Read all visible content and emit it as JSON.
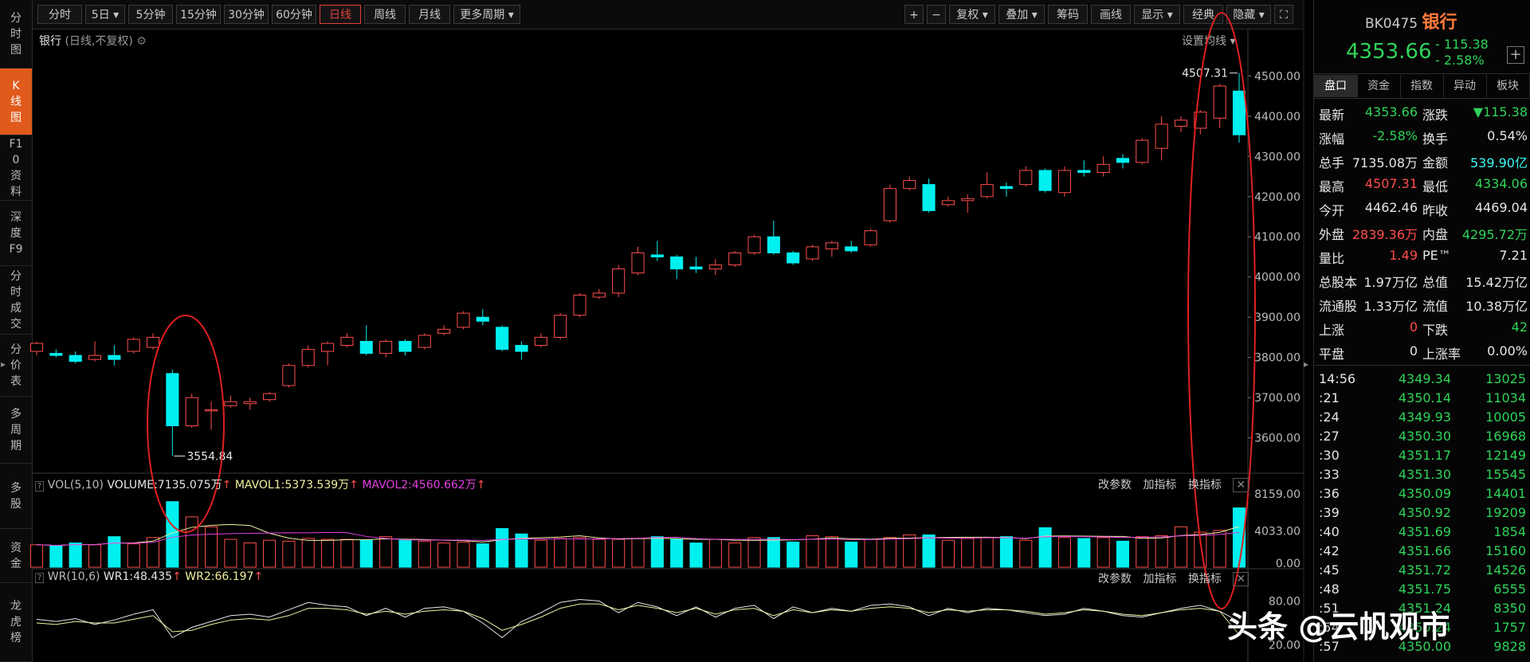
{
  "left_nav": [
    {
      "label": "分时图",
      "active": false
    },
    {
      "label": "K线图",
      "active": true
    },
    {
      "label": "F10资料",
      "active": false
    },
    {
      "label": "深度F9",
      "active": false
    },
    {
      "label": "分时成交",
      "active": false
    },
    {
      "label": "分价表",
      "active": false
    },
    {
      "label": "多周期",
      "active": false
    },
    {
      "label": "多股",
      "active": false
    },
    {
      "label": "资金",
      "active": false
    },
    {
      "label": "龙虎榜",
      "active": false
    }
  ],
  "toolbar": {
    "periods": [
      "分时",
      "5日 ▾",
      "5分钟",
      "15分钟",
      "30分钟",
      "60分钟",
      "日线",
      "周线",
      "月线",
      "更多周期 ▾"
    ],
    "active_period": "日线",
    "right_buttons": [
      "+",
      "−",
      "复权 ▾",
      "叠加 ▾",
      "筹码",
      "画线",
      "显示 ▾",
      "经典",
      "隐藏 ▾",
      "⛶"
    ]
  },
  "chart_header": {
    "name": "银行",
    "subtitle": "(日线,不复权)",
    "ma_settings": "设置均线 ▾",
    "high_label": "4507.31",
    "low_label": "3554.84",
    "y_ticks": [
      "4500.00",
      "4400.00",
      "4300.00",
      "4200.00",
      "4100.00",
      "4000.00",
      "3900.00",
      "3800.00",
      "3700.00",
      "3600.00"
    ]
  },
  "volume_panel": {
    "indicator": "VOL(5,10)",
    "volume": "VOLUME:7135.075万",
    "mavol1": "MAVOL1:5373.539万",
    "mavol2": "MAVOL2:4560.662万",
    "buttons": [
      "改参数",
      "加指标",
      "换指标"
    ],
    "y_ticks": [
      "8159.00",
      "4033.00",
      "0.00"
    ]
  },
  "wr_panel": {
    "indicator": "WR(10,6)",
    "wr1": "WR1:48.435",
    "wr2": "WR2:66.197",
    "buttons": [
      "改参数",
      "加指标",
      "换指标"
    ],
    "y_ticks": [
      "80.00",
      "20.00"
    ]
  },
  "quote": {
    "code": "BK0475",
    "name": "银行",
    "price": "4353.66",
    "change": "- 115.38",
    "change_pct": "- 2.58%",
    "tabs": [
      "盘口",
      "资金",
      "指数",
      "异动",
      "板块"
    ],
    "rows": [
      {
        "l1": "最新",
        "v1": "4353.66",
        "c1": "green",
        "l2": "涨跌",
        "v2": "▼115.38",
        "c2": "green"
      },
      {
        "l1": "涨幅",
        "v1": "-2.58%",
        "c1": "green",
        "l2": "换手",
        "v2": "0.54%",
        "c2": "white"
      },
      {
        "l1": "总手",
        "v1": "7135.08万",
        "c1": "white",
        "l2": "金额",
        "v2": "539.90亿",
        "c2": "cyan"
      },
      {
        "l1": "最高",
        "v1": "4507.31",
        "c1": "red",
        "l2": "最低",
        "v2": "4334.06",
        "c2": "green"
      },
      {
        "l1": "今开",
        "v1": "4462.46",
        "c1": "white",
        "l2": "昨收",
        "v2": "4469.04",
        "c2": "white"
      },
      {
        "l1": "外盘",
        "v1": "2839.36万",
        "c1": "red",
        "l2": "内盘",
        "v2": "4295.72万",
        "c2": "green"
      },
      {
        "l1": "量比",
        "v1": "1.49",
        "c1": "red",
        "l2": "PE™",
        "v2": "7.21",
        "c2": "white"
      },
      {
        "l1": "总股本",
        "v1": "1.97万亿",
        "c1": "white",
        "l2": "总值",
        "v2": "15.42万亿",
        "c2": "white"
      },
      {
        "l1": "流通股",
        "v1": "1.33万亿",
        "c1": "white",
        "l2": "流值",
        "v2": "10.38万亿",
        "c2": "white"
      },
      {
        "l1": "上涨",
        "v1": "0",
        "c1": "red",
        "l2": "下跌",
        "v2": "42",
        "c2": "green"
      },
      {
        "l1": "平盘",
        "v1": "0",
        "c1": "white",
        "l2": "上涨率",
        "v2": "0.00%",
        "c2": "white"
      }
    ],
    "ticks": [
      {
        "t": "14:56",
        "p": "4349.34",
        "v": "13025"
      },
      {
        "t": ":21",
        "p": "4350.14",
        "v": "11034"
      },
      {
        "t": ":24",
        "p": "4349.93",
        "v": "10005"
      },
      {
        "t": ":27",
        "p": "4350.30",
        "v": "16968"
      },
      {
        "t": ":30",
        "p": "4351.17",
        "v": "12149"
      },
      {
        "t": ":33",
        "p": "4351.30",
        "v": "15545"
      },
      {
        "t": ":36",
        "p": "4350.09",
        "v": "14401"
      },
      {
        "t": ":39",
        "p": "4350.92",
        "v": "19209"
      },
      {
        "t": ":40",
        "p": "4351.69",
        "v": "1854"
      },
      {
        "t": ":42",
        "p": "4351.66",
        "v": "15160"
      },
      {
        "t": ":45",
        "p": "4351.72",
        "v": "14526"
      },
      {
        "t": ":48",
        "p": "4351.75",
        "v": "6555"
      },
      {
        "t": ":51",
        "p": "4351.24",
        "v": "8350"
      },
      {
        "t": ":54",
        "p": "4350.24",
        "v": "1757"
      },
      {
        "t": ":57",
        "p": "4350.00",
        "v": "9828"
      }
    ]
  },
  "watermark": "头条 @云帆观市",
  "colors": {
    "up": "#ff4d4d",
    "down": "#00f0f0",
    "accent": "#e05a1b",
    "ma1": "#f0f0a0",
    "ma2": "#e040e0",
    "circle": "#e02020"
  },
  "chart_data": {
    "type": "candlestick",
    "series": [
      {
        "o": 3815,
        "c": 3835,
        "h": 3840,
        "l": 3805
      },
      {
        "o": 3810,
        "c": 3805,
        "h": 3820,
        "l": 3800
      },
      {
        "o": 3805,
        "c": 3790,
        "h": 3815,
        "l": 3785
      },
      {
        "o": 3795,
        "c": 3805,
        "h": 3840,
        "l": 3790
      },
      {
        "o": 3805,
        "c": 3795,
        "h": 3830,
        "l": 3780
      },
      {
        "o": 3815,
        "c": 3845,
        "h": 3850,
        "l": 3810
      },
      {
        "o": 3825,
        "c": 3850,
        "h": 3860,
        "l": 3820
      },
      {
        "o": 3760,
        "c": 3630,
        "h": 3770,
        "l": 3554.84
      },
      {
        "o": 3630,
        "c": 3700,
        "h": 3710,
        "l": 3625
      },
      {
        "o": 3670,
        "c": 3670,
        "h": 3690,
        "l": 3620
      },
      {
        "o": 3680,
        "c": 3690,
        "h": 3705,
        "l": 3675
      },
      {
        "o": 3685,
        "c": 3690,
        "h": 3700,
        "l": 3670
      },
      {
        "o": 3695,
        "c": 3710,
        "h": 3715,
        "l": 3690
      },
      {
        "o": 3730,
        "c": 3780,
        "h": 3785,
        "l": 3725
      },
      {
        "o": 3780,
        "c": 3820,
        "h": 3830,
        "l": 3775
      },
      {
        "o": 3815,
        "c": 3835,
        "h": 3840,
        "l": 3780
      },
      {
        "o": 3830,
        "c": 3850,
        "h": 3860,
        "l": 3825
      },
      {
        "o": 3840,
        "c": 3810,
        "h": 3880,
        "l": 3805
      },
      {
        "o": 3810,
        "c": 3840,
        "h": 3845,
        "l": 3800
      },
      {
        "o": 3840,
        "c": 3815,
        "h": 3845,
        "l": 3805
      },
      {
        "o": 3825,
        "c": 3855,
        "h": 3860,
        "l": 3820
      },
      {
        "o": 3860,
        "c": 3870,
        "h": 3880,
        "l": 3855
      },
      {
        "o": 3875,
        "c": 3910,
        "h": 3915,
        "l": 3870
      },
      {
        "o": 3900,
        "c": 3890,
        "h": 3920,
        "l": 3880
      },
      {
        "o": 3875,
        "c": 3820,
        "h": 3880,
        "l": 3815
      },
      {
        "o": 3830,
        "c": 3815,
        "h": 3840,
        "l": 3795
      },
      {
        "o": 3830,
        "c": 3850,
        "h": 3860,
        "l": 3825
      },
      {
        "o": 3850,
        "c": 3905,
        "h": 3910,
        "l": 3845
      },
      {
        "o": 3905,
        "c": 3955,
        "h": 3960,
        "l": 3900
      },
      {
        "o": 3950,
        "c": 3960,
        "h": 3970,
        "l": 3945
      },
      {
        "o": 3960,
        "c": 4020,
        "h": 4030,
        "l": 3950
      },
      {
        "o": 4010,
        "c": 4060,
        "h": 4075,
        "l": 4005
      },
      {
        "o": 4055,
        "c": 4050,
        "h": 4090,
        "l": 4040
      },
      {
        "o": 4050,
        "c": 4020,
        "h": 4055,
        "l": 3995
      },
      {
        "o": 4025,
        "c": 4020,
        "h": 4050,
        "l": 4010
      },
      {
        "o": 4020,
        "c": 4030,
        "h": 4045,
        "l": 4005
      },
      {
        "o": 4030,
        "c": 4060,
        "h": 4065,
        "l": 4025
      },
      {
        "o": 4060,
        "c": 4100,
        "h": 4105,
        "l": 4055
      },
      {
        "o": 4100,
        "c": 4060,
        "h": 4140,
        "l": 4055
      },
      {
        "o": 4060,
        "c": 4035,
        "h": 4065,
        "l": 4030
      },
      {
        "o": 4045,
        "c": 4075,
        "h": 4080,
        "l": 4040
      },
      {
        "o": 4070,
        "c": 4085,
        "h": 4090,
        "l": 4050
      },
      {
        "o": 4075,
        "c": 4065,
        "h": 4090,
        "l": 4060
      },
      {
        "o": 4080,
        "c": 4115,
        "h": 4120,
        "l": 4075
      },
      {
        "o": 4140,
        "c": 4220,
        "h": 4230,
        "l": 4135
      },
      {
        "o": 4220,
        "c": 4240,
        "h": 4250,
        "l": 4215
      },
      {
        "o": 4230,
        "c": 4165,
        "h": 4245,
        "l": 4160
      },
      {
        "o": 4180,
        "c": 4190,
        "h": 4200,
        "l": 4175
      },
      {
        "o": 4190,
        "c": 4195,
        "h": 4205,
        "l": 4160
      },
      {
        "o": 4200,
        "c": 4230,
        "h": 4260,
        "l": 4195
      },
      {
        "o": 4225,
        "c": 4220,
        "h": 4235,
        "l": 4200
      },
      {
        "o": 4230,
        "c": 4265,
        "h": 4275,
        "l": 4225
      },
      {
        "o": 4265,
        "c": 4215,
        "h": 4270,
        "l": 4210
      },
      {
        "o": 4210,
        "c": 4265,
        "h": 4275,
        "l": 4200
      },
      {
        "o": 4265,
        "c": 4260,
        "h": 4290,
        "l": 4250
      },
      {
        "o": 4260,
        "c": 4280,
        "h": 4300,
        "l": 4250
      },
      {
        "o": 4295,
        "c": 4285,
        "h": 4305,
        "l": 4270
      },
      {
        "o": 4285,
        "c": 4340,
        "h": 4345,
        "l": 4280
      },
      {
        "o": 4320,
        "c": 4380,
        "h": 4400,
        "l": 4290
      },
      {
        "o": 4375,
        "c": 4390,
        "h": 4400,
        "l": 4360
      },
      {
        "o": 4370,
        "c": 4410,
        "h": 4415,
        "l": 4355
      },
      {
        "o": 4395,
        "c": 4475,
        "h": 4480,
        "l": 4370
      },
      {
        "o": 4462.46,
        "c": 4353.66,
        "h": 4507.31,
        "l": 4334.06
      }
    ],
    "volume": [
      2500,
      2350,
      2700,
      2500,
      3400,
      2600,
      3300,
      7300,
      5600,
      4500,
      3100,
      2700,
      3000,
      2900,
      3200,
      3100,
      3100,
      3000,
      3400,
      3000,
      2900,
      2700,
      2800,
      2600,
      4300,
      3700,
      3000,
      3200,
      3300,
      3100,
      3100,
      3200,
      3400,
      3100,
      2700,
      3100,
      2700,
      3300,
      3300,
      2800,
      3500,
      3400,
      2800,
      3100,
      3300,
      3600,
      3600,
      3000,
      3200,
      3300,
      3400,
      3000,
      4400,
      3300,
      3200,
      3300,
      2900,
      3400,
      3500,
      4500,
      3900,
      4100,
      6600
    ],
    "wr1": [
      45,
      48,
      44,
      52,
      46,
      38,
      32,
      70,
      56,
      48,
      40,
      38,
      42,
      32,
      22,
      26,
      28,
      40,
      30,
      42,
      30,
      28,
      34,
      50,
      70,
      48,
      36,
      22,
      18,
      20,
      36,
      22,
      28,
      40,
      28,
      42,
      30,
      26,
      44,
      28,
      36,
      30,
      34,
      26,
      24,
      28,
      40,
      30,
      36,
      30,
      32,
      36,
      40,
      38,
      30,
      34,
      40,
      42,
      36,
      30,
      26,
      34,
      48
    ],
    "wr2": [
      50,
      52,
      48,
      50,
      50,
      45,
      40,
      62,
      60,
      52,
      46,
      44,
      46,
      40,
      30,
      30,
      32,
      38,
      34,
      38,
      34,
      32,
      34,
      44,
      60,
      52,
      42,
      30,
      24,
      24,
      32,
      26,
      30,
      36,
      30,
      38,
      32,
      30,
      40,
      32,
      36,
      32,
      34,
      30,
      28,
      30,
      36,
      32,
      34,
      32,
      32,
      34,
      38,
      36,
      32,
      34,
      38,
      40,
      36,
      32,
      30,
      34,
      66
    ]
  }
}
